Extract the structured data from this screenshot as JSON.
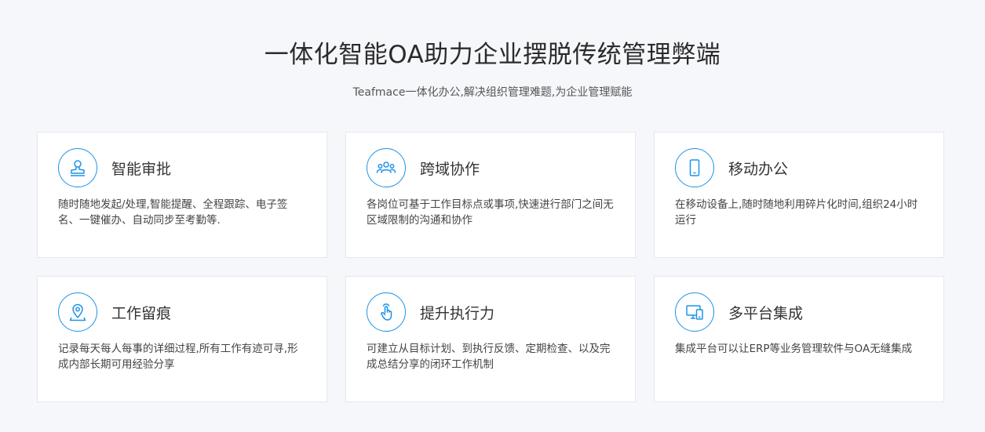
{
  "header": {
    "title": "一体化智能OA助力企业摆脱传统管理弊端",
    "subtitle": "Teafmace一体化办公,解决组织管理难题,为企业管理赋能"
  },
  "accent_color": "#1e93e6",
  "cards": [
    {
      "title": "智能审批",
      "desc": "随时随地发起/处理,智能提醒、全程跟踪、电子签名、一键催办、自动同步至考勤等.",
      "icon": "stamp-icon"
    },
    {
      "title": "跨域协作",
      "desc": "各岗位可基于工作目标点或事项,快速进行部门之间无区域限制的沟通和协作",
      "icon": "team-icon"
    },
    {
      "title": "移动办公",
      "desc": "在移动设备上,随时随地利用碎片化时间,组织24小时运行",
      "icon": "phone-icon"
    },
    {
      "title": "工作留痕",
      "desc": "记录每天每人每事的详细过程,所有工作有迹可寻,形成内部长期可用经验分享",
      "icon": "location-pin-icon"
    },
    {
      "title": "提升执行力",
      "desc": "可建立从目标计划、到执行反馈、定期检查、以及完成总结分享的闭环工作机制",
      "icon": "touch-hand-icon"
    },
    {
      "title": "多平台集成",
      "desc": "集成平台可以让ERP等业务管理软件与OA无缝集成",
      "icon": "multi-device-icon"
    }
  ]
}
